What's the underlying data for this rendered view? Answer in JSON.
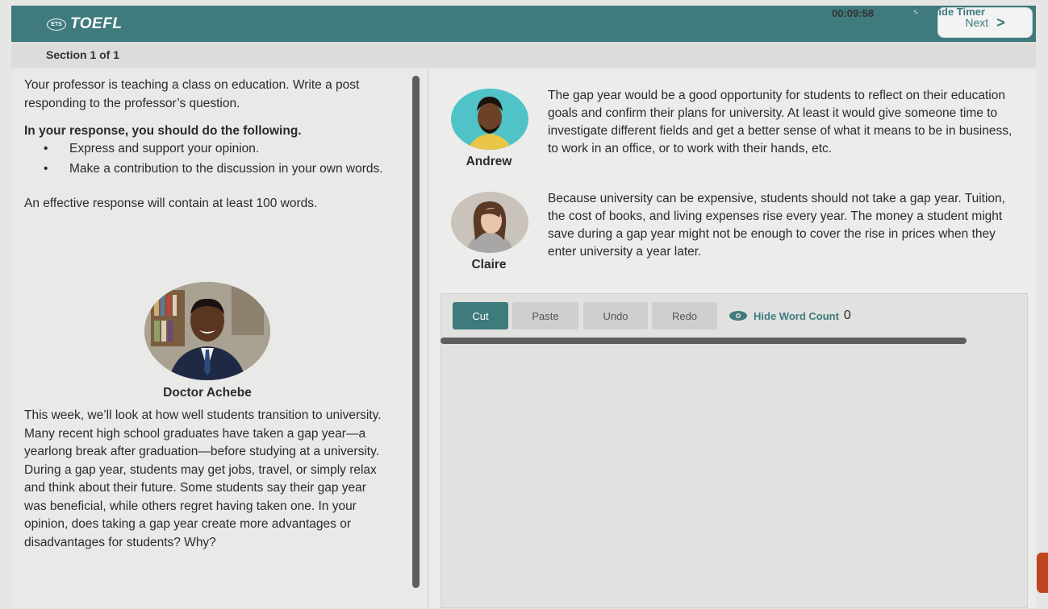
{
  "header": {
    "logo_badge": "ETS",
    "logo_text": "TOEFL",
    "next_label": "Next",
    "accent_color": "#3f7a7d"
  },
  "subbar": {
    "section": "Section 1 of 1",
    "timer": "00:09:58",
    "hide_timer": "Hide Timer"
  },
  "instructions": {
    "intro": "Your professor is teaching a class on education. Write a post responding to the professor’s question.",
    "heading": "In your response, you should do the following.",
    "bullets": [
      "Express and support your opinion.",
      "Make a contribution to the discussion in your own words."
    ],
    "length_note": "An effective response will contain at least 100 words."
  },
  "professor": {
    "name": "Doctor Achebe",
    "text": "This week, we’ll look at how well students transition to university. Many recent high school graduates have taken a gap year—a yearlong break after graduation—before studying at a university. During a gap year, students may get jobs, travel, or simply relax and think about their future. Some students say their gap year was beneficial, while others regret having taken one. In your opinion, does taking a gap year create more advantages or disadvantages for students? Why?"
  },
  "students": [
    {
      "name": "Andrew",
      "text": "The gap year would be a good opportunity for students to reflect on their education goals and confirm their plans for university. At least it would give someone time to investigate different fields and get a better sense of what it means to be in business, to work in an office, or to work with their hands, etc."
    },
    {
      "name": "Claire",
      "text": "Because university can be expensive, students should not take a gap year. Tuition, the cost of books, and living expenses rise every year. The money a student might save during a gap year might not be enough to cover the rise in prices when they enter university a year later."
    }
  ],
  "editor": {
    "cut": "Cut",
    "paste": "Paste",
    "undo": "Undo",
    "redo": "Redo",
    "hide_word_count": "Hide Word Count",
    "word_count": "0",
    "value": ""
  }
}
